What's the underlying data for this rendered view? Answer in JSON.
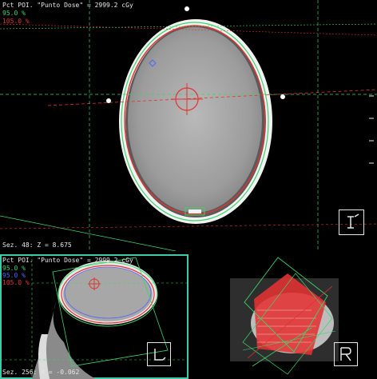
{
  "axial": {
    "poi_label": "Pct POI. \"Punto Dose\" = 2999.2 cGy",
    "iso_green": "95.0 %",
    "iso_red": "105.0 %",
    "slice": "Sez. 48: Z = 8.675",
    "orientation_icon": "orientation-cube-icon"
  },
  "sagittal": {
    "poi_label": "Pct POI. \"Punto Dose\" = 2999.2 cGy",
    "iso_green": "95.0 %",
    "iso_blue": "95.0 %",
    "iso_red": "105.0 %",
    "slice": "Sez. 256: X = -0.062"
  },
  "volume": {
    "orientation_icon": "orientation-cube-icon"
  },
  "colors": {
    "isodose_red": "#e43232",
    "isodose_green": "#3bd46a",
    "isodose_blue": "#4f66ff",
    "active_border": "#3ec9a9"
  }
}
